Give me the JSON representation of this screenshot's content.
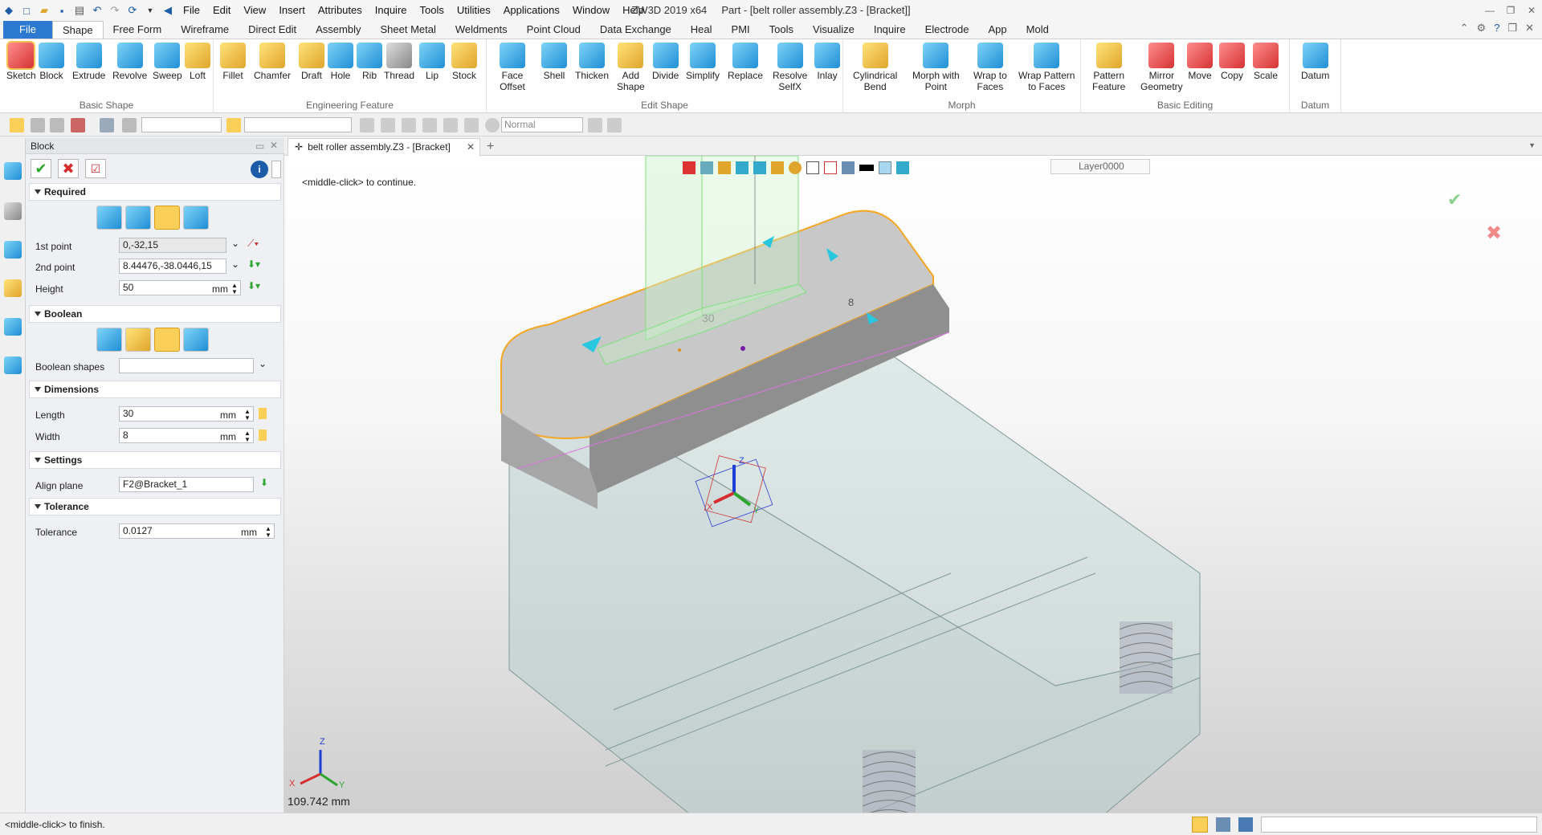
{
  "title": {
    "app": "ZW3D 2019  x64",
    "doc": "Part - [belt roller assembly.Z3 - [Bracket]]"
  },
  "menu": [
    "File",
    "Edit",
    "View",
    "Insert",
    "Attributes",
    "Inquire",
    "Tools",
    "Utilities",
    "Applications",
    "Window",
    "Help"
  ],
  "ribbon_tabs": [
    "File",
    "Shape",
    "Free Form",
    "Wireframe",
    "Direct Edit",
    "Assembly",
    "Sheet Metal",
    "Weldments",
    "Point Cloud",
    "Data Exchange",
    "Heal",
    "PMI",
    "Tools",
    "Visualize",
    "Inquire",
    "Electrode",
    "App",
    "Mold"
  ],
  "ribbon_groups": {
    "basic_shape": {
      "label": "Basic Shape",
      "items": [
        "Sketch",
        "Block",
        "Extrude",
        "Revolve",
        "Sweep",
        "Loft"
      ]
    },
    "engineering": {
      "label": "Engineering Feature",
      "items": [
        "Fillet",
        "Chamfer",
        "Draft",
        "Hole",
        "Rib",
        "Thread",
        "Lip",
        "Stock"
      ]
    },
    "edit_shape": {
      "label": "Edit Shape",
      "items": [
        [
          "Face",
          "Offset"
        ],
        [
          "Shell"
        ],
        [
          "Thicken"
        ],
        [
          "Add",
          "Shape"
        ],
        [
          "Divide"
        ],
        [
          "Simplify"
        ],
        [
          "Replace"
        ],
        [
          "Resolve",
          "SelfX"
        ],
        [
          "Inlay"
        ]
      ]
    },
    "morph": {
      "label": "Morph",
      "items": [
        [
          "Cylindrical",
          "Bend"
        ],
        [
          "Morph with",
          "Point"
        ],
        [
          "Wrap to",
          "Faces"
        ],
        [
          "Wrap Pattern",
          "to Faces"
        ]
      ]
    },
    "basic_editing": {
      "label": "Basic Editing",
      "items": [
        [
          "Pattern",
          "Feature"
        ],
        [
          "Mirror",
          "Geometry"
        ],
        [
          "Move"
        ],
        [
          "Copy"
        ],
        [
          "Scale"
        ]
      ]
    },
    "datum": {
      "label": "Datum",
      "items": [
        "Datum"
      ]
    }
  },
  "toolbar": {
    "style_combo": "Normal"
  },
  "panel": {
    "title": "Block",
    "sections": {
      "required": "Required",
      "boolean": "Boolean",
      "dimensions": "Dimensions",
      "settings": "Settings",
      "tolerance": "Tolerance"
    },
    "fields": {
      "first_point_label": "1st point",
      "first_point": "0,-32,15",
      "second_point_label": "2nd point",
      "second_point": "8.44476,-38.0446,15",
      "height_label": "Height",
      "height": "50",
      "height_unit": "mm",
      "boolean_shapes_label": "Boolean shapes",
      "boolean_shapes": "",
      "length_label": "Length",
      "length": "30",
      "length_unit": "mm",
      "width_label": "Width",
      "width": "8",
      "width_unit": "mm",
      "align_plane_label": "Align plane",
      "align_plane": "F2@Bracket_1",
      "tolerance_label": "Tolerance",
      "tolerance": "0.0127",
      "tolerance_unit": "mm"
    }
  },
  "doc_tab": "belt roller assembly.Z3 - [Bracket]",
  "viewport": {
    "prompt": "<middle-click> to continue.",
    "layer": "Layer0000",
    "dim_length": "30",
    "dim_width": "8",
    "scale_readout": "109.742 mm",
    "axis_x": "X",
    "axis_y": "Y",
    "axis_z": "Z"
  },
  "status": {
    "message": "<middle-click> to finish."
  },
  "colors": {
    "accent": "#2b79d0",
    "highlight": "#f5a623",
    "ok": "#2ea62e",
    "cancel": "#d62e2e",
    "part": "#b8cfcd"
  }
}
